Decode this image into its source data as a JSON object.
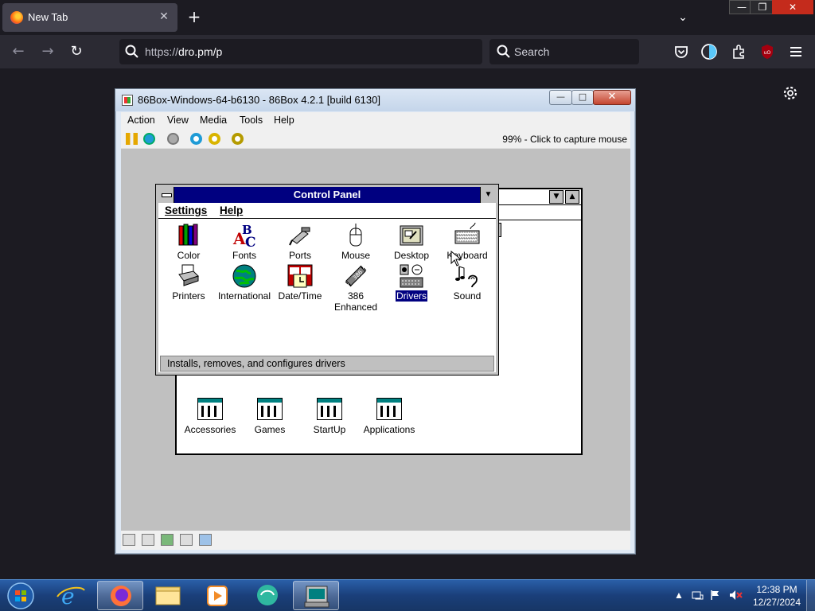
{
  "browser": {
    "tab_title": "New Tab",
    "tab_close": "✕",
    "new_tab": "+",
    "tab_list": "⌄",
    "window_min": "—",
    "window_max": "❐",
    "window_close": "✕",
    "back": "←",
    "forward": "→",
    "reload": "↻",
    "url_protocol": "https://",
    "url_rest": "dro.pm/p",
    "search_placeholder": "Search",
    "accent": "#42414d"
  },
  "box86": {
    "title": "86Box-Windows-64-b6130 - 86Box 4.2.1 [build 6130]",
    "min": "—",
    "max": "□",
    "close": "✕",
    "menu": [
      "Action",
      "View",
      "Media",
      "Tools",
      "Help"
    ],
    "status": "99% - Click to capture mouse"
  },
  "win31": {
    "control_panel": {
      "title": "Control Panel",
      "menu": [
        "Settings",
        "Help"
      ],
      "items": [
        {
          "label": "Color",
          "icon": "color-icon"
        },
        {
          "label": "Fonts",
          "icon": "fonts-icon"
        },
        {
          "label": "Ports",
          "icon": "ports-icon"
        },
        {
          "label": "Mouse",
          "icon": "mouse-icon"
        },
        {
          "label": "Desktop",
          "icon": "desktop-icon"
        },
        {
          "label": "Keyboard",
          "icon": "keyboard-icon"
        },
        {
          "label": "Printers",
          "icon": "printers-icon"
        },
        {
          "label": "International",
          "icon": "globe-icon"
        },
        {
          "label": "Date/Time",
          "icon": "clock-icon"
        },
        {
          "label": "386 Enhanced",
          "icon": "chip-icon"
        },
        {
          "label": "Drivers",
          "icon": "drivers-icon"
        },
        {
          "label": "Sound",
          "icon": "sound-icon"
        }
      ],
      "selected": "Drivers",
      "status": "Installs, removes, and configures drivers"
    },
    "program_groups": [
      "Accessories",
      "Games",
      "StartUp",
      "Applications"
    ]
  },
  "taskbar": {
    "time": "12:38 PM",
    "date": "12/27/2024"
  }
}
